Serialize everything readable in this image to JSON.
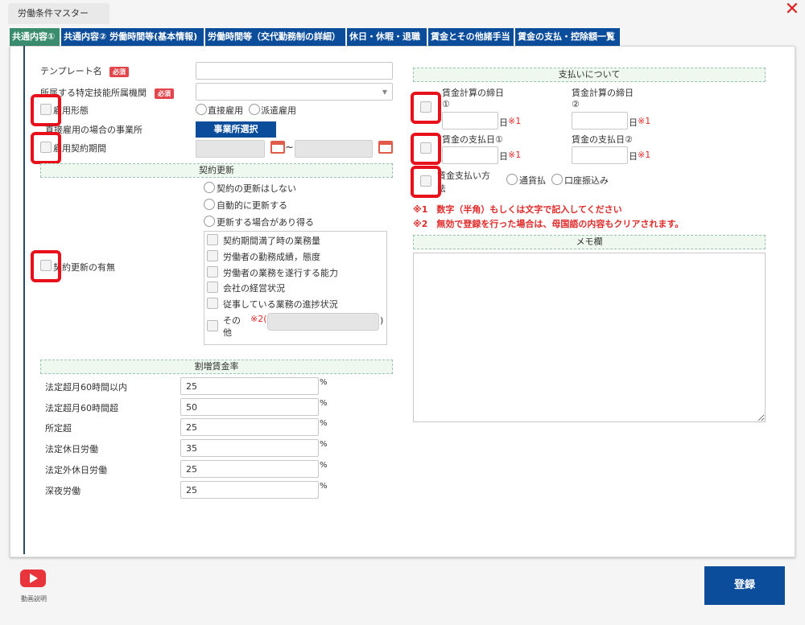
{
  "window": {
    "title": "労働条件マスター",
    "close_symbol": "✕"
  },
  "tabs": [
    {
      "label": "共通内容①"
    },
    {
      "label": "共通内容② 労働時間等(基本情報)"
    },
    {
      "label": "労働時間等（交代勤務制の詳細）"
    },
    {
      "label": "休日・休暇・退職"
    },
    {
      "label": "賃金とその他諸手当"
    },
    {
      "label": "賃金の支払・控除額一覧"
    }
  ],
  "left": {
    "template_name": "テンプレート名",
    "required_badge": "必須",
    "institution": "所属する特定技能所属機関",
    "employment_type": "雇用形態",
    "direct": "直接雇用",
    "dispatch": "派遣雇用",
    "office_direct": "直接雇用の場合の事業所",
    "office_select_btn": "事業所選択",
    "contract_period": "雇用契約期間",
    "tilde": "~",
    "contract_renewal_section": "契約更新",
    "renewal_options": [
      "契約の更新はしない",
      "自動的に更新する",
      "更新する場合があり得る"
    ],
    "renewal_label": "契約更新の有無",
    "reasons": [
      "契約期間満了時の業務量",
      "労働者の勤務成績，態度",
      "労働者の業務を遂行する能力",
      "会社の経営状況",
      "従事している業務の進捗状況"
    ],
    "reason_other_1": "その",
    "reason_other_2": "他",
    "mark2_paren": "※2(",
    "paren_close": ")",
    "premium_section": "割増賃金率",
    "premium_rows": [
      {
        "label": "法定超月60時間以内",
        "value": "25"
      },
      {
        "label": "法定超月60時間超",
        "value": "50"
      },
      {
        "label": "所定超",
        "value": "25"
      },
      {
        "label": "法定休日労働",
        "value": "35"
      },
      {
        "label": "法定外休日労働",
        "value": "25"
      },
      {
        "label": "深夜労働",
        "value": "25"
      }
    ],
    "percent": "%"
  },
  "right": {
    "payment_section": "支払いについて",
    "cutoff1_a": "賃金計算の締日",
    "cutoff1_b": "①",
    "cutoff2_a": "賃金計算の締日",
    "cutoff2_b": "②",
    "payday1": "賃金の支払日①",
    "payday2": "賃金の支払日②",
    "day_unit": "日",
    "mark1": "※1",
    "method_a": "賃金支払い方",
    "method_b": "法",
    "cash": "通貨払",
    "bank": "口座振込み",
    "note1": "※1　数字（半角）もしくは文字で記入してください",
    "note2": "※2　無効で登録を行った場合は、母国語の内容もクリアされます。",
    "memo_section": "メモ欄"
  },
  "footer": {
    "video_label": "動画説明",
    "register": "登録"
  },
  "colors": {
    "accent_blue": "#0b4d9a",
    "active_tab": "#3a8c6e",
    "highlight_red": "#e8101a",
    "required_red": "#e2454c"
  }
}
